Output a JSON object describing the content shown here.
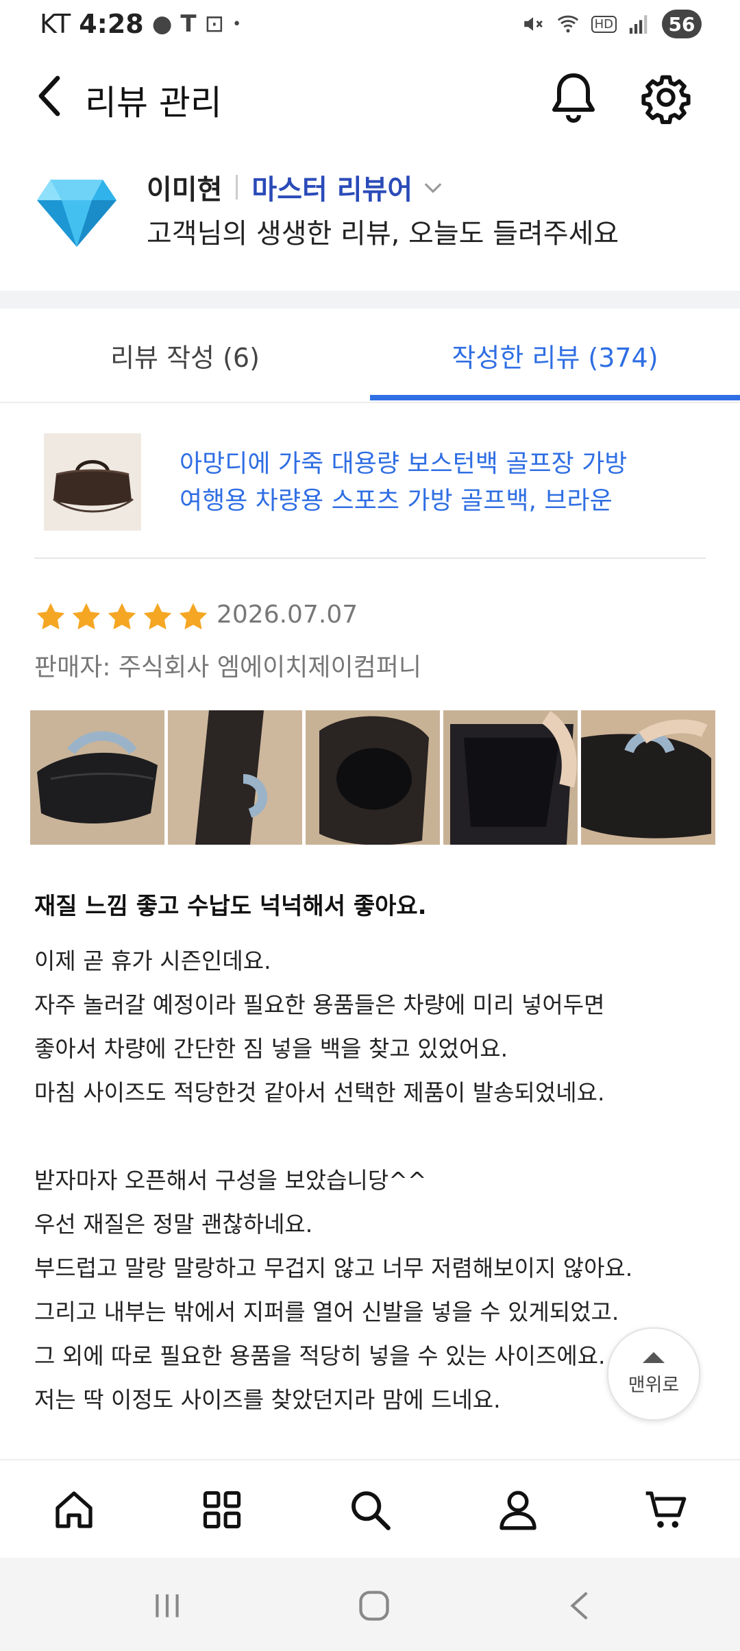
{
  "status_bar": {
    "carrier": "KT",
    "time": "4:28",
    "battery": "56",
    "hd": "HD"
  },
  "app_bar": {
    "title": "리뷰 관리"
  },
  "profile": {
    "name": "이미현",
    "level": "마스터 리뷰어",
    "subtitle": "고객님의 생생한 리뷰, 오늘도 들려주세요"
  },
  "tabs": [
    {
      "label": "리뷰 작성 (6)",
      "active": false
    },
    {
      "label": "작성한 리뷰 (374)",
      "active": true
    }
  ],
  "product": {
    "name_line1": "아망디에 가죽 대용량 보스턴백 골프장 가방",
    "name_line2": "여행용 차량용 스포츠 가방 골프백, 브라운"
  },
  "review": {
    "rating": 5,
    "date": "2026.07.07",
    "seller": "판매자: 주식회사 엠에이치제이컴퍼니",
    "photo_count": 5,
    "headline": "재질 느낌 좋고 수납도 넉넉해서 좋아요.",
    "body_lines": [
      "이제 곧 휴가 시즌인데요.",
      "자주 놀러갈 예정이라 필요한 용품들은 차량에 미리 넣어두면",
      "좋아서 차량에 간단한 짐 넣을 백을 찾고 있었어요.",
      "마침 사이즈도 적당한것 같아서 선택한 제품이 발송되었네요.",
      "",
      "받자마자 오픈해서 구성을 보았습니당^^",
      "우선 재질은 정말 괜찮하네요.",
      "부드럽고 말랑 말랑하고 무겁지 않고 너무 저렴해보이지 않아요.",
      "그리고 내부는 밖에서 지퍼를 열어 신발을 넣을 수 있게되었고.",
      "그 외에 따로 필요한 용품을 적당히 넣을 수 있는 사이즈에요.",
      "저는 딱 이정도 사이즈를 찾았던지라 맘에 드네요."
    ]
  },
  "scroll_top": {
    "label": "맨위로"
  },
  "bottom_nav": [
    "home-icon",
    "grid-icon",
    "search-icon",
    "person-icon",
    "cart-icon"
  ],
  "system_nav": [
    "recents-icon",
    "home-button-icon",
    "back-icon"
  ],
  "colors": {
    "accent": "#2f6ee3",
    "level": "#2a4bb8",
    "star": "#f5a623"
  }
}
